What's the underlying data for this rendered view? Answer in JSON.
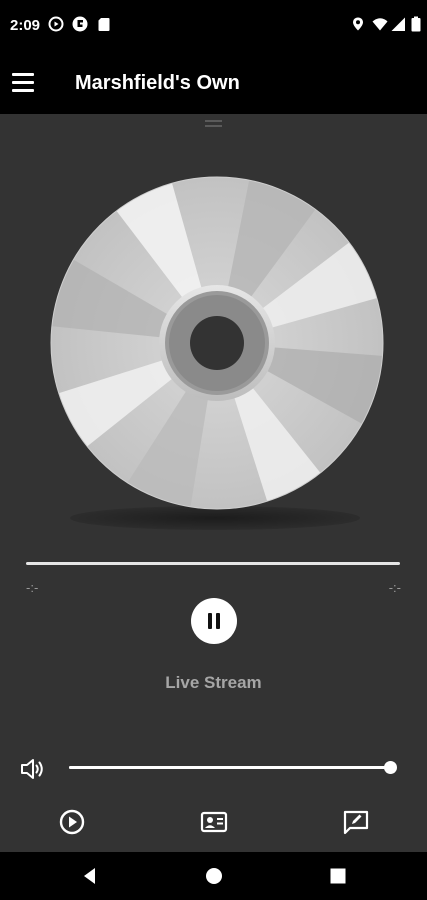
{
  "status_bar": {
    "time": "2:09",
    "left_icons": [
      "play-circle-icon",
      "flipboard-icon",
      "sd-card-icon"
    ],
    "right_icons": [
      "location-icon",
      "wifi-icon",
      "signal-icon",
      "battery-icon"
    ]
  },
  "app_bar": {
    "title": "Marshfield's Own",
    "menu_icon": "hamburger-menu-icon"
  },
  "player": {
    "artwork": "compact-disc",
    "progress": {
      "elapsed": "-:-",
      "remaining": "-:-"
    },
    "state": "playing",
    "stream_label": "Live Stream",
    "volume": {
      "level": 1.0,
      "icon": "speaker-icon"
    }
  },
  "bottom_actions": [
    {
      "name": "play-circle-icon"
    },
    {
      "name": "contact-card-icon"
    },
    {
      "name": "edit-message-icon"
    }
  ],
  "navigation_bar": {
    "buttons": [
      "back-icon",
      "home-icon",
      "recents-icon"
    ]
  },
  "colors": {
    "background": "#333333",
    "bars": "#000000",
    "accent": "#ffffff",
    "muted_text": "#a6a6a6"
  }
}
